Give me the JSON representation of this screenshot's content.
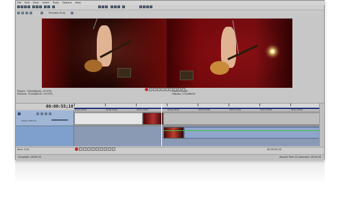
{
  "menu": [
    "File",
    "Edit",
    "View",
    "Insert",
    "Tools",
    "Options",
    "Help"
  ],
  "toolbar2": {
    "preview_label": "Preview (Full)"
  },
  "preview": {
    "project_line": "Project:  720x480x32, 29.970i",
    "preview_line": "Preview:  720x480x32, 29.970i",
    "frame_line": "Frame:    1,649",
    "display_line": "Display:  170x98x32"
  },
  "timeline": {
    "timecode": "00:00:55;18",
    "ruler_labels": [
      "00:00:00;00",
      "00:00:15;00",
      "00:00:30;00",
      "00:00:45;00",
      "00:01:00;00",
      "00:01:15;00",
      "00:01:30;00",
      "00:01:45;00"
    ],
    "track1_level": "Level: 100.0 %"
  },
  "bottom": {
    "rate": "Rate: 0.00",
    "end_time": "00:00:55;18"
  },
  "status": {
    "left": "Complete: 00:00:00",
    "right": "Record Time (2 channels): 49:24:00"
  }
}
